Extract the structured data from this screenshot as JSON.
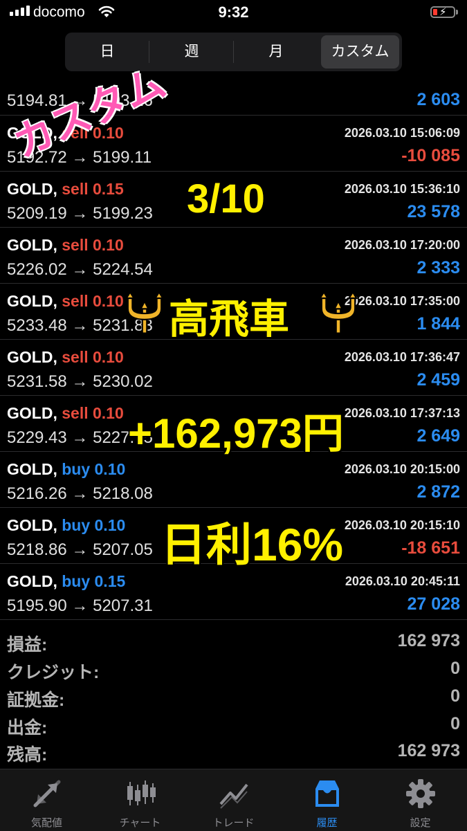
{
  "status_bar": {
    "carrier": "docomo",
    "time": "9:32"
  },
  "segments": [
    {
      "label": "日",
      "active": false
    },
    {
      "label": "週",
      "active": false
    },
    {
      "label": "月",
      "active": false
    },
    {
      "label": "カスタム",
      "active": true
    }
  ],
  "partial_row": {
    "prices": "5194.81 → 5193.16",
    "profit": "2 603"
  },
  "trades": [
    {
      "symbol": "GOLD,",
      "side": "sell",
      "volume": "0.10",
      "datetime": "2026.03.10 15:06:09",
      "prices": "5192.72 → 5199.11",
      "profit": "-10 085"
    },
    {
      "symbol": "GOLD,",
      "side": "sell",
      "volume": "0.15",
      "datetime": "2026.03.10 15:36:10",
      "prices": "5209.19 → 5199.23",
      "profit": "23 578"
    },
    {
      "symbol": "GOLD,",
      "side": "sell",
      "volume": "0.10",
      "datetime": "2026.03.10 17:20:00",
      "prices": "5226.02 → 5224.54",
      "profit": "2 333"
    },
    {
      "symbol": "GOLD,",
      "side": "sell",
      "volume": "0.10",
      "datetime": "2026.03.10 17:35:00",
      "prices": "5233.48 → 5231.83",
      "profit": "1 844"
    },
    {
      "symbol": "GOLD,",
      "side": "sell",
      "volume": "0.10",
      "datetime": "2026.03.10 17:36:47",
      "prices": "5231.58 → 5230.02",
      "profit": "2 459"
    },
    {
      "symbol": "GOLD,",
      "side": "sell",
      "volume": "0.10",
      "datetime": "2026.03.10 17:37:13",
      "prices": "5229.43 → 5227.75",
      "profit": "2 649"
    },
    {
      "symbol": "GOLD,",
      "side": "buy",
      "volume": "0.10",
      "datetime": "2026.03.10 20:15:00",
      "prices": "5216.26 → 5218.08",
      "profit": "2 872"
    },
    {
      "symbol": "GOLD,",
      "side": "buy",
      "volume": "0.10",
      "datetime": "2026.03.10 20:15:10",
      "prices": "5218.86 → 5207.05",
      "profit": "-18 651"
    },
    {
      "symbol": "GOLD,",
      "side": "buy",
      "volume": "0.15",
      "datetime": "2026.03.10 20:45:11",
      "prices": "5195.90 → 5207.31",
      "profit": "27 028"
    }
  ],
  "summary": [
    {
      "label": "損益:",
      "value": "162 973"
    },
    {
      "label": "クレジット:",
      "value": "0"
    },
    {
      "label": "証拠金:",
      "value": "0"
    },
    {
      "label": "出金:",
      "value": "0"
    },
    {
      "label": "残高:",
      "value": "162 973"
    }
  ],
  "tabbar": [
    {
      "label": "気配値",
      "icon": "quotes-icon",
      "active": false
    },
    {
      "label": "チャート",
      "icon": "chart-icon",
      "active": false
    },
    {
      "label": "トレード",
      "icon": "trade-icon",
      "active": false
    },
    {
      "label": "履歴",
      "icon": "history-icon",
      "active": true
    },
    {
      "label": "設定",
      "icon": "settings-icon",
      "active": false
    }
  ],
  "overlay": {
    "custom_text": "カスタム",
    "date_text": "3/10",
    "name_text": "高飛車",
    "amount_text": "+162,973円",
    "rate_text": "日利16%"
  },
  "colors": {
    "sell": "#e84c3d",
    "buy": "#2b8cf0",
    "overlay_yellow": "#fff000",
    "overlay_pink": "#ff5ab5"
  }
}
